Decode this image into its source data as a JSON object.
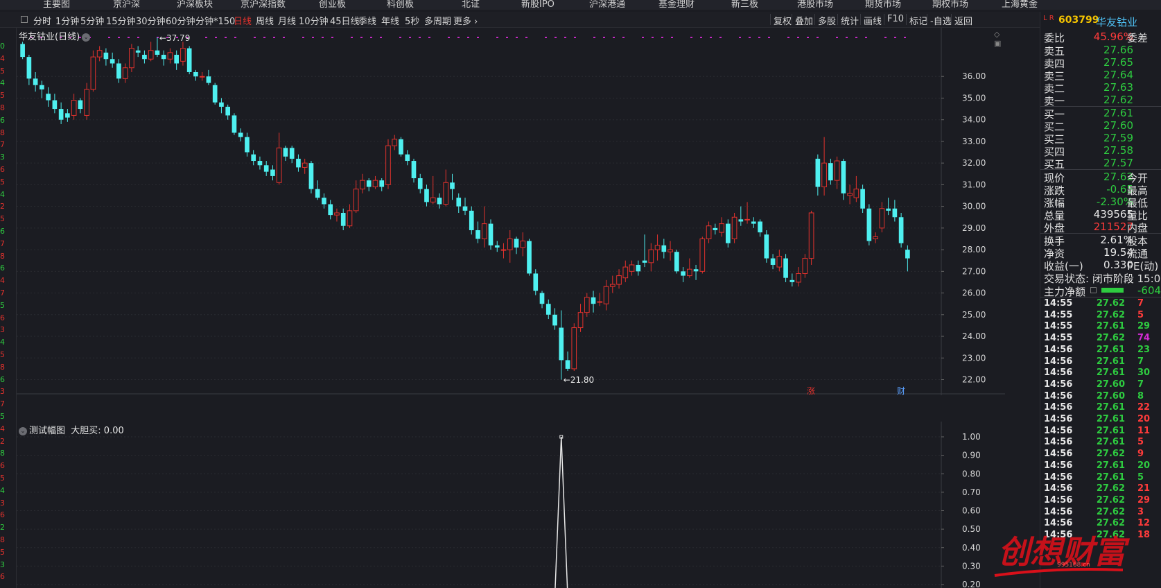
{
  "top_nav": [
    "主要图",
    "京沪深",
    "沪深板块",
    "京沪深指数",
    "创业板",
    "科创板",
    "北证",
    "新股IPO",
    "沪深港通",
    "基金理财",
    "新三板",
    "港股市场",
    "期货市场",
    "期权市场",
    "上海黄金"
  ],
  "periods": [
    {
      "label": "分时",
      "active": false
    },
    {
      "label": "1分钟",
      "active": false
    },
    {
      "label": "5分钟",
      "active": false
    },
    {
      "label": "15分钟",
      "active": false
    },
    {
      "label": "30分钟",
      "active": false
    },
    {
      "label": "60分钟",
      "active": false
    },
    {
      "label": "分钟*150",
      "active": false
    },
    {
      "label": "日线",
      "active": true
    },
    {
      "label": "周线",
      "active": false
    },
    {
      "label": "月线",
      "active": false
    },
    {
      "label": "10分钟",
      "active": false
    },
    {
      "label": "45日线",
      "active": false
    },
    {
      "label": "季线",
      "active": false
    },
    {
      "label": "年线",
      "active": false
    },
    {
      "label": "5秒",
      "active": false
    },
    {
      "label": "多周期",
      "active": false
    },
    {
      "label": "更多 ›",
      "active": false
    }
  ],
  "tools": [
    "复权",
    "叠加",
    "多股",
    "统计",
    "画线",
    "F10",
    "标记",
    "-自选",
    "返回"
  ],
  "chart": {
    "title": "华友钴业(日线)",
    "sub_title": "测试幅图",
    "sub_indicator": "大胆买: 0.00",
    "max_label": "37.79",
    "min_label": "21.80",
    "tag_rise": "涨",
    "tag_finance": "财"
  },
  "chart_data": {
    "type": "candlestick",
    "y_axis_ticks": [
      "36.00",
      "35.00",
      "34.00",
      "33.00",
      "32.00",
      "31.00",
      "30.00",
      "29.00",
      "28.00",
      "27.00",
      "26.00",
      "25.00",
      "24.00",
      "23.00",
      "22.00"
    ],
    "ylim": [
      21.6,
      37.8
    ],
    "up_color": "#e2322d",
    "down_color": "#4ff0f0",
    "candles": [
      [
        37.5,
        36.9,
        37.6,
        36.8
      ],
      [
        36.9,
        35.9,
        37.0,
        35.6
      ],
      [
        35.9,
        35.6,
        36.2,
        35.3
      ],
      [
        35.6,
        35.4,
        35.8,
        35.0
      ],
      [
        35.2,
        34.9,
        35.5,
        34.6
      ],
      [
        34.9,
        34.5,
        35.2,
        34.3
      ],
      [
        34.5,
        34.0,
        34.8,
        33.8
      ],
      [
        34.3,
        34.1,
        34.5,
        33.9
      ],
      [
        34.2,
        34.9,
        35.2,
        34.0
      ],
      [
        34.9,
        34.5,
        35.0,
        34.3
      ],
      [
        34.2,
        35.4,
        35.7,
        34.0
      ],
      [
        35.4,
        36.9,
        37.2,
        35.3
      ],
      [
        36.9,
        37.2,
        37.4,
        36.7
      ],
      [
        37.1,
        36.8,
        37.3,
        36.5
      ],
      [
        36.8,
        36.6,
        37.1,
        36.4
      ],
      [
        36.6,
        35.9,
        36.8,
        35.7
      ],
      [
        35.9,
        36.4,
        36.6,
        35.7
      ],
      [
        36.4,
        37.3,
        37.5,
        36.2
      ],
      [
        37.2,
        37.1,
        37.4,
        36.9
      ],
      [
        37.0,
        36.8,
        37.2,
        36.6
      ],
      [
        36.8,
        37.2,
        37.6,
        36.7
      ],
      [
        37.2,
        37.0,
        37.8,
        36.9
      ],
      [
        37.0,
        36.8,
        37.2,
        36.5
      ],
      [
        36.8,
        37.1,
        37.3,
        36.6
      ],
      [
        37.0,
        36.6,
        37.2,
        36.3
      ],
      [
        36.7,
        37.3,
        37.6,
        36.5
      ],
      [
        37.3,
        36.2,
        37.4,
        36.1
      ],
      [
        36.2,
        36.0,
        36.3,
        35.8
      ],
      [
        36.0,
        36.0,
        36.2,
        35.8
      ],
      [
        36.0,
        35.7,
        36.3,
        35.6
      ],
      [
        35.6,
        34.8,
        35.7,
        34.7
      ],
      [
        34.8,
        34.6,
        35.0,
        34.3
      ],
      [
        34.6,
        34.2,
        34.7,
        34.0
      ],
      [
        34.2,
        33.4,
        34.3,
        33.3
      ],
      [
        33.4,
        33.2,
        33.6,
        33.0
      ],
      [
        33.2,
        32.5,
        33.4,
        32.3
      ],
      [
        32.4,
        32.1,
        32.6,
        31.9
      ],
      [
        32.1,
        31.9,
        32.3,
        31.7
      ],
      [
        31.9,
        31.6,
        32.1,
        31.4
      ],
      [
        31.7,
        31.4,
        31.9,
        31.2
      ],
      [
        31.1,
        32.7,
        33.4,
        31.0
      ],
      [
        32.7,
        32.3,
        32.8,
        32.1
      ],
      [
        32.7,
        32.2,
        32.8,
        32.0
      ],
      [
        32.2,
        31.8,
        32.4,
        31.6
      ],
      [
        31.8,
        32.0,
        32.2,
        31.5
      ],
      [
        32.0,
        30.8,
        32.1,
        30.6
      ],
      [
        30.8,
        30.4,
        31.2,
        30.3
      ],
      [
        30.4,
        30.1,
        30.6,
        29.9
      ],
      [
        30.1,
        29.6,
        30.3,
        29.4
      ],
      [
        29.6,
        29.7,
        29.9,
        29.3
      ],
      [
        29.7,
        29.1,
        29.9,
        28.9
      ],
      [
        29.1,
        29.8,
        30.1,
        29.0
      ],
      [
        29.8,
        30.8,
        31.2,
        29.7
      ],
      [
        30.8,
        31.2,
        31.5,
        30.6
      ],
      [
        31.2,
        30.9,
        31.3,
        30.7
      ],
      [
        30.9,
        31.2,
        31.4,
        30.8
      ],
      [
        31.2,
        30.9,
        31.3,
        30.7
      ],
      [
        31.0,
        32.8,
        33.1,
        30.8
      ],
      [
        32.8,
        33.1,
        33.3,
        32.6
      ],
      [
        33.1,
        32.4,
        33.2,
        32.3
      ],
      [
        32.4,
        32.1,
        32.6,
        31.9
      ],
      [
        32.1,
        31.3,
        32.2,
        31.1
      ],
      [
        31.3,
        30.8,
        31.5,
        30.6
      ],
      [
        30.8,
        30.2,
        31.0,
        30.0
      ],
      [
        30.2,
        30.4,
        31.4,
        30.1
      ],
      [
        30.4,
        30.1,
        30.6,
        29.9
      ],
      [
        30.1,
        31.1,
        31.7,
        30.0
      ],
      [
        31.1,
        30.8,
        31.5,
        30.3
      ],
      [
        30.4,
        30.0,
        30.6,
        29.7
      ],
      [
        30.0,
        29.8,
        30.4,
        29.6
      ],
      [
        29.8,
        28.9,
        30.0,
        28.7
      ],
      [
        28.9,
        28.5,
        29.3,
        28.3
      ],
      [
        28.5,
        29.2,
        30.0,
        28.1
      ],
      [
        29.2,
        28.2,
        29.4,
        28.0
      ],
      [
        28.2,
        28.1,
        28.4,
        27.9
      ],
      [
        28.0,
        28.0,
        28.3,
        27.6
      ],
      [
        28.0,
        28.5,
        28.9,
        27.4
      ],
      [
        28.5,
        28.1,
        28.6,
        27.8
      ],
      [
        28.1,
        28.4,
        28.8,
        27.7
      ],
      [
        28.4,
        26.9,
        28.5,
        26.8
      ],
      [
        26.9,
        26.1,
        27.1,
        25.9
      ],
      [
        26.0,
        25.5,
        26.1,
        25.3
      ],
      [
        25.5,
        25.0,
        25.7,
        24.8
      ],
      [
        25.0,
        24.5,
        25.3,
        24.3
      ],
      [
        24.4,
        22.9,
        25.2,
        22.0
      ],
      [
        22.9,
        22.5,
        23.3,
        22.4
      ],
      [
        22.5,
        24.4,
        24.6,
        22.4
      ],
      [
        24.4,
        25.1,
        25.5,
        24.2
      ],
      [
        25.1,
        25.8,
        26.0,
        24.9
      ],
      [
        25.8,
        25.5,
        26.1,
        25.1
      ],
      [
        25.6,
        25.6,
        26.0,
        25.4
      ],
      [
        25.5,
        26.3,
        26.6,
        25.2
      ],
      [
        26.3,
        26.4,
        26.8,
        26.0
      ],
      [
        26.4,
        26.8,
        27.1,
        26.2
      ],
      [
        26.7,
        27.2,
        27.5,
        26.5
      ],
      [
        27.0,
        27.3,
        27.5,
        26.8
      ],
      [
        27.3,
        27.0,
        27.5,
        26.8
      ],
      [
        27.5,
        27.4,
        28.7,
        27.2
      ],
      [
        27.4,
        28.0,
        28.3,
        27.0
      ],
      [
        28.0,
        28.2,
        28.7,
        27.5
      ],
      [
        28.2,
        27.9,
        28.5,
        27.6
      ],
      [
        27.9,
        28.0,
        28.4,
        27.5
      ],
      [
        27.9,
        27.0,
        28.0,
        26.9
      ],
      [
        27.0,
        26.8,
        27.2,
        26.5
      ],
      [
        26.8,
        27.1,
        27.6,
        26.7
      ],
      [
        27.1,
        27.0,
        27.3,
        26.6
      ],
      [
        27.0,
        28.5,
        28.6,
        26.9
      ],
      [
        28.5,
        29.1,
        29.3,
        28.3
      ],
      [
        29.0,
        28.9,
        29.2,
        28.7
      ],
      [
        28.8,
        29.2,
        29.5,
        28.6
      ],
      [
        29.2,
        28.3,
        29.4,
        28.1
      ],
      [
        28.5,
        29.5,
        29.7,
        28.3
      ],
      [
        29.4,
        29.3,
        30.0,
        29.1
      ],
      [
        29.4,
        29.4,
        30.2,
        29.2
      ],
      [
        29.3,
        29.2,
        29.5,
        29.0
      ],
      [
        29.3,
        28.8,
        29.4,
        28.6
      ],
      [
        28.7,
        27.6,
        28.9,
        27.4
      ],
      [
        27.6,
        27.3,
        27.8,
        27.1
      ],
      [
        27.2,
        27.7,
        28.0,
        27.0
      ],
      [
        27.6,
        26.7,
        27.8,
        26.5
      ],
      [
        26.6,
        26.5,
        26.9,
        26.3
      ],
      [
        26.5,
        26.9,
        27.2,
        26.3
      ],
      [
        26.9,
        27.6,
        27.8,
        26.7
      ],
      [
        27.6,
        29.7,
        29.8,
        27.3
      ],
      [
        32.2,
        30.9,
        32.4,
        30.5
      ],
      [
        30.9,
        32.0,
        33.2,
        30.5
      ],
      [
        32.0,
        31.2,
        32.2,
        31.0
      ],
      [
        31.2,
        32.1,
        32.3,
        30.8
      ],
      [
        32.1,
        30.6,
        32.2,
        30.3
      ],
      [
        30.5,
        30.6,
        31.0,
        30.1
      ],
      [
        30.4,
        30.8,
        31.4,
        30.2
      ],
      [
        30.8,
        29.9,
        31.0,
        29.7
      ],
      [
        29.9,
        28.4,
        30.1,
        28.2
      ],
      [
        28.5,
        28.6,
        28.8,
        28.3
      ],
      [
        29.0,
        29.9,
        30.2,
        28.8
      ],
      [
        29.9,
        29.8,
        30.4,
        29.6
      ],
      [
        29.9,
        29.5,
        30.3,
        29.3
      ],
      [
        29.5,
        28.3,
        29.7,
        28.1
      ],
      [
        28.0,
        27.6,
        28.2,
        27.0
      ]
    ],
    "sub_values": {
      "peak_index": 84,
      "peak_value": 1.0
    },
    "sub_y_ticks": [
      "1.00",
      "0.90",
      "0.80",
      "0.70",
      "0.60",
      "0.50",
      "0.40",
      "0.30",
      "0.20"
    ],
    "sub_ylim": [
      0,
      1.05
    ]
  },
  "quote": {
    "code": "603799",
    "name": "华友钴业",
    "lr": "L R",
    "ratio": {
      "label": "委比",
      "value": "45.96%",
      "right": "委差"
    },
    "asks": [
      {
        "label": "卖五",
        "price": "27.66"
      },
      {
        "label": "卖四",
        "price": "27.65"
      },
      {
        "label": "卖三",
        "price": "27.64"
      },
      {
        "label": "卖二",
        "price": "27.63"
      },
      {
        "label": "卖一",
        "price": "27.62"
      }
    ],
    "bids": [
      {
        "label": "买一",
        "price": "27.61"
      },
      {
        "label": "买二",
        "price": "27.60"
      },
      {
        "label": "买三",
        "price": "27.59"
      },
      {
        "label": "买四",
        "price": "27.58"
      },
      {
        "label": "买五",
        "price": "27.57"
      }
    ],
    "stats": [
      {
        "label": "现价",
        "value": "27.62",
        "color": "green",
        "right": "今开"
      },
      {
        "label": "涨跌",
        "value": "-0.65",
        "color": "green",
        "right": "最高"
      },
      {
        "label": "涨幅",
        "value": "-2.30%",
        "color": "green",
        "right": "最低"
      },
      {
        "label": "总量",
        "value": "439565",
        "color": "white",
        "right": "量比"
      },
      {
        "label": "外盘",
        "value": "211527",
        "color": "red",
        "right": "内盘"
      }
    ],
    "stats2": [
      {
        "label": "换手",
        "value": "2.61%",
        "right": "股本"
      },
      {
        "label": "净资",
        "value": "19.54",
        "right": "流通"
      },
      {
        "label": "收益(一)",
        "value": "0.330",
        "right": "PE(动)"
      }
    ],
    "trade_status": "交易状态: 闭市阶段 15:0",
    "main_net": {
      "label": "主力净额",
      "value": "-604"
    },
    "ticks": [
      {
        "t": "14:55",
        "p": "27.62",
        "n": "7",
        "nc": "red"
      },
      {
        "t": "14:55",
        "p": "27.62",
        "n": "5",
        "nc": "red"
      },
      {
        "t": "14:55",
        "p": "27.61",
        "n": "29",
        "nc": "green"
      },
      {
        "t": "14:55",
        "p": "27.62",
        "n": "74",
        "nc": "magenta"
      },
      {
        "t": "14:56",
        "p": "27.61",
        "n": "23",
        "nc": "green"
      },
      {
        "t": "14:56",
        "p": "27.61",
        "n": "7",
        "nc": "green"
      },
      {
        "t": "14:56",
        "p": "27.61",
        "n": "30",
        "nc": "green"
      },
      {
        "t": "14:56",
        "p": "27.60",
        "n": "7",
        "nc": "green"
      },
      {
        "t": "14:56",
        "p": "27.60",
        "n": "8",
        "nc": "green"
      },
      {
        "t": "14:56",
        "p": "27.61",
        "n": "22",
        "nc": "red"
      },
      {
        "t": "14:56",
        "p": "27.61",
        "n": "20",
        "nc": "red"
      },
      {
        "t": "14:56",
        "p": "27.61",
        "n": "11",
        "nc": "red"
      },
      {
        "t": "14:56",
        "p": "27.61",
        "n": "5",
        "nc": "red"
      },
      {
        "t": "14:56",
        "p": "27.62",
        "n": "9",
        "nc": "red"
      },
      {
        "t": "14:56",
        "p": "27.61",
        "n": "20",
        "nc": "green"
      },
      {
        "t": "14:56",
        "p": "27.61",
        "n": "5",
        "nc": "green"
      },
      {
        "t": "14:56",
        "p": "27.62",
        "n": "21",
        "nc": "red"
      },
      {
        "t": "14:56",
        "p": "27.62",
        "n": "29",
        "nc": "red"
      },
      {
        "t": "14:56",
        "p": "27.62",
        "n": "3",
        "nc": "red"
      },
      {
        "t": "14:56",
        "p": "27.62",
        "n": "12",
        "nc": "red"
      },
      {
        "t": "14:56",
        "p": "27.62",
        "n": "18",
        "nc": "red"
      }
    ]
  },
  "left_gutter": [
    "0",
    "4",
    "5",
    "4",
    "5",
    "8",
    "6",
    "8",
    "7",
    "3",
    "6",
    "5",
    "4",
    "2",
    "5",
    "6",
    "7",
    "8",
    "6",
    "4",
    "7",
    "5",
    "6",
    "3",
    "4",
    "5",
    "8",
    "6",
    "3",
    "7",
    "5",
    "4",
    "2",
    "8",
    "6",
    "5",
    "4",
    "3",
    "6",
    "2",
    "8",
    "5",
    "3",
    "6"
  ],
  "watermark": {
    "text": "创想财富",
    "url": "995168.cn"
  }
}
